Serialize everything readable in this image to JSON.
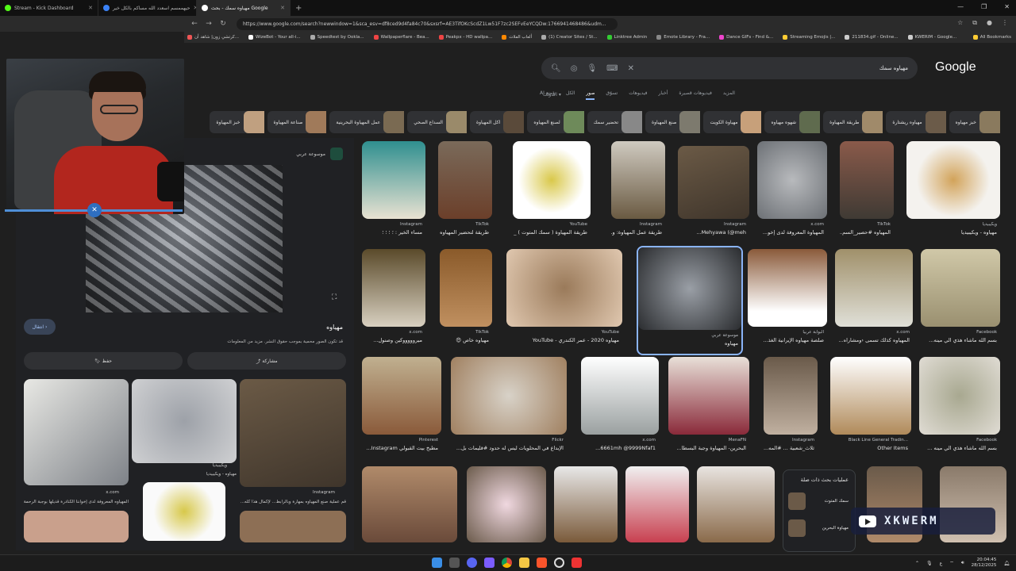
{
  "tabs": [
    {
      "label": "Stream - Kick Dashboard",
      "color": "#53fc18"
    },
    {
      "label": "حيهممسم اسعدد الله مساكم بالكل خير",
      "color": "#3b82f6"
    },
    {
      "label": "مهياوه سمك - بحث Google",
      "color": "#ffffff",
      "active": true
    }
  ],
  "address": {
    "url": "https://www.google.com/search?newwindow=1&sca_esv=df8ced9d4fa84c70&sxsrf=AE3TifOKcScdZ1Lw51F7zc2SEFvEeYCQDw:1766941468486&udm..."
  },
  "bookmarks": [
    {
      "label": "كرتشي زون| شاهد أن...",
      "color": "#e55"
    },
    {
      "label": "WizeBot - Your all-i...",
      "color": "#fff"
    },
    {
      "label": "Speedtest by Ookla...",
      "color": "#aaa"
    },
    {
      "label": "Wallpaperflare - Bea...",
      "color": "#e44"
    },
    {
      "label": "Peakpx - HD wallpa...",
      "color": "#e44"
    },
    {
      "label": "ألعاب الفلات",
      "color": "#f80"
    },
    {
      "label": "(1) Creator Sites / St...",
      "color": "#aaa"
    },
    {
      "label": "Linktree Admin",
      "color": "#3c3"
    },
    {
      "label": "Emote Library - Fra...",
      "color": "#888"
    },
    {
      "label": "Dance GIFs - Find &...",
      "color": "#e4c"
    },
    {
      "label": "Streaming Emojis |...",
      "color": "#fc3"
    },
    {
      "label": "211834.gif - Online...",
      "color": "#ccc"
    },
    {
      "label": "KWERIM - Google...",
      "color": "#ccc"
    },
    {
      "label": "All Bookmarks",
      "color": "#fc3"
    }
  ],
  "search": {
    "query": "مهياوه سمك",
    "logo": "Google"
  },
  "filters": [
    {
      "label": "وضع AI"
    },
    {
      "label": "الكل"
    },
    {
      "label": "صور",
      "active": true
    },
    {
      "label": "تسوّق"
    },
    {
      "label": "فيديوهات"
    },
    {
      "label": "أخبار"
    },
    {
      "label": "فيديوهات قصيرة"
    },
    {
      "label": "المزيد"
    }
  ],
  "tools_label": "الأدوات",
  "chips": [
    "خبز مهياوه",
    "مهياوه ريشتارة",
    "طريقة المهياوة",
    "شهوه مهياوه",
    "مهياوة الكويت",
    "صنع المهياوة",
    "تحضير سمك",
    "لصنع المهياوه",
    "اكل المهياوة",
    "السداع الصحي",
    "عمل المهياوة البحرينية",
    "صناعة المهياوة",
    "خبز المهياوة"
  ],
  "preview": {
    "source": "موسوعة عربي",
    "title": "مهياوه",
    "description": "قد تكون الصور محمية بموجب حقوق النشر. مزيد من المعلومات",
    "visit_label": "انتقال",
    "share_label": "مشاركة",
    "save_label": "حفظ",
    "related": [
      {
        "source": "x.com",
        "caption": "المهياوه المعروفة لدى إخواننا الكنادرة قديلها بوجبة الرحمة ..."
      },
      {
        "source": "ويكيبيديا",
        "caption": "مهياوه - ويكيبيديا"
      },
      {
        "source": "Instagram",
        "caption": "قم عملية صنع المهياوه بمهارة وبالرابط... لإكمال هذا كله..."
      }
    ]
  },
  "results": [
    {
      "source": "Instagram",
      "caption": "مساء الخير : ؛ ؛ ؛ ؛"
    },
    {
      "source": "TikTok",
      "caption": "طريقة لتحضير المهياوه ..."
    },
    {
      "source": "YouTube",
      "caption": "طريقة المهياوة ( سمك المتوت ) _ ..."
    },
    {
      "source": "Instagram",
      "caption": "طريقة عمل المهياوة: و..."
    },
    {
      "source": "Instagram",
      "caption": "Mehyawa (@meh..."
    },
    {
      "source": "x.com",
      "caption": "المهياوة المعروفة لدى إخو..."
    },
    {
      "source": "TikTok",
      "caption": "المهياوه #حصير_السم..."
    },
    {
      "source": "ويكيبيديا",
      "caption": "مهياوه - ويكيبيديا"
    },
    {
      "source": "x.com",
      "caption": "ميروووووكين وصنول..."
    },
    {
      "source": "TikTok",
      "caption": "مهياوه خاص 😍"
    },
    {
      "source": "YouTube",
      "caption": "مهياوه 2020 - عمر الكندري - YouTube"
    },
    {
      "source": "موسوعة عربي",
      "caption": "مهياوه"
    },
    {
      "source": "البوابة عربيا",
      "caption": "صلصة مهياوه الإيرانية الغذ..."
    },
    {
      "source": "x.com",
      "caption": "المهياوه كذلك تسمى ‹ومشاراه..."
    },
    {
      "source": "Facebook",
      "caption": "بسم الله ماشاء هذي الي مينه..."
    },
    {
      "source": "Pinterest",
      "caption": "مطبخ بيت القبولي Instagram..."
    },
    {
      "source": "Flickr",
      "caption": "الإبداع في المحلويات ليس له حدود #قليمات بل..."
    },
    {
      "source": "x.com",
      "caption": "6661mh @9999Nfaf1..."
    },
    {
      "source": "MenaFN",
      "caption": "البحرين- المهياوة وجبة البسطا..."
    },
    {
      "source": "Instagram",
      "caption": "ثلاث_شعبية ... #المه..."
    },
    {
      "source": "Black Line General Tradin...",
      "caption": "Other Items"
    },
    {
      "source": "Facebook",
      "caption": "بسم الله ماشاء هذي الي مينه ..."
    }
  ],
  "related_searches": {
    "title": "عمليات بحث ذات صلة",
    "items": [
      "سمك المتوت",
      "مهياوة البحرين"
    ]
  },
  "overlay": {
    "name": "XKWERM"
  },
  "clock": {
    "time": "20:04:45",
    "date": "28/12/2025"
  },
  "language": "ع"
}
